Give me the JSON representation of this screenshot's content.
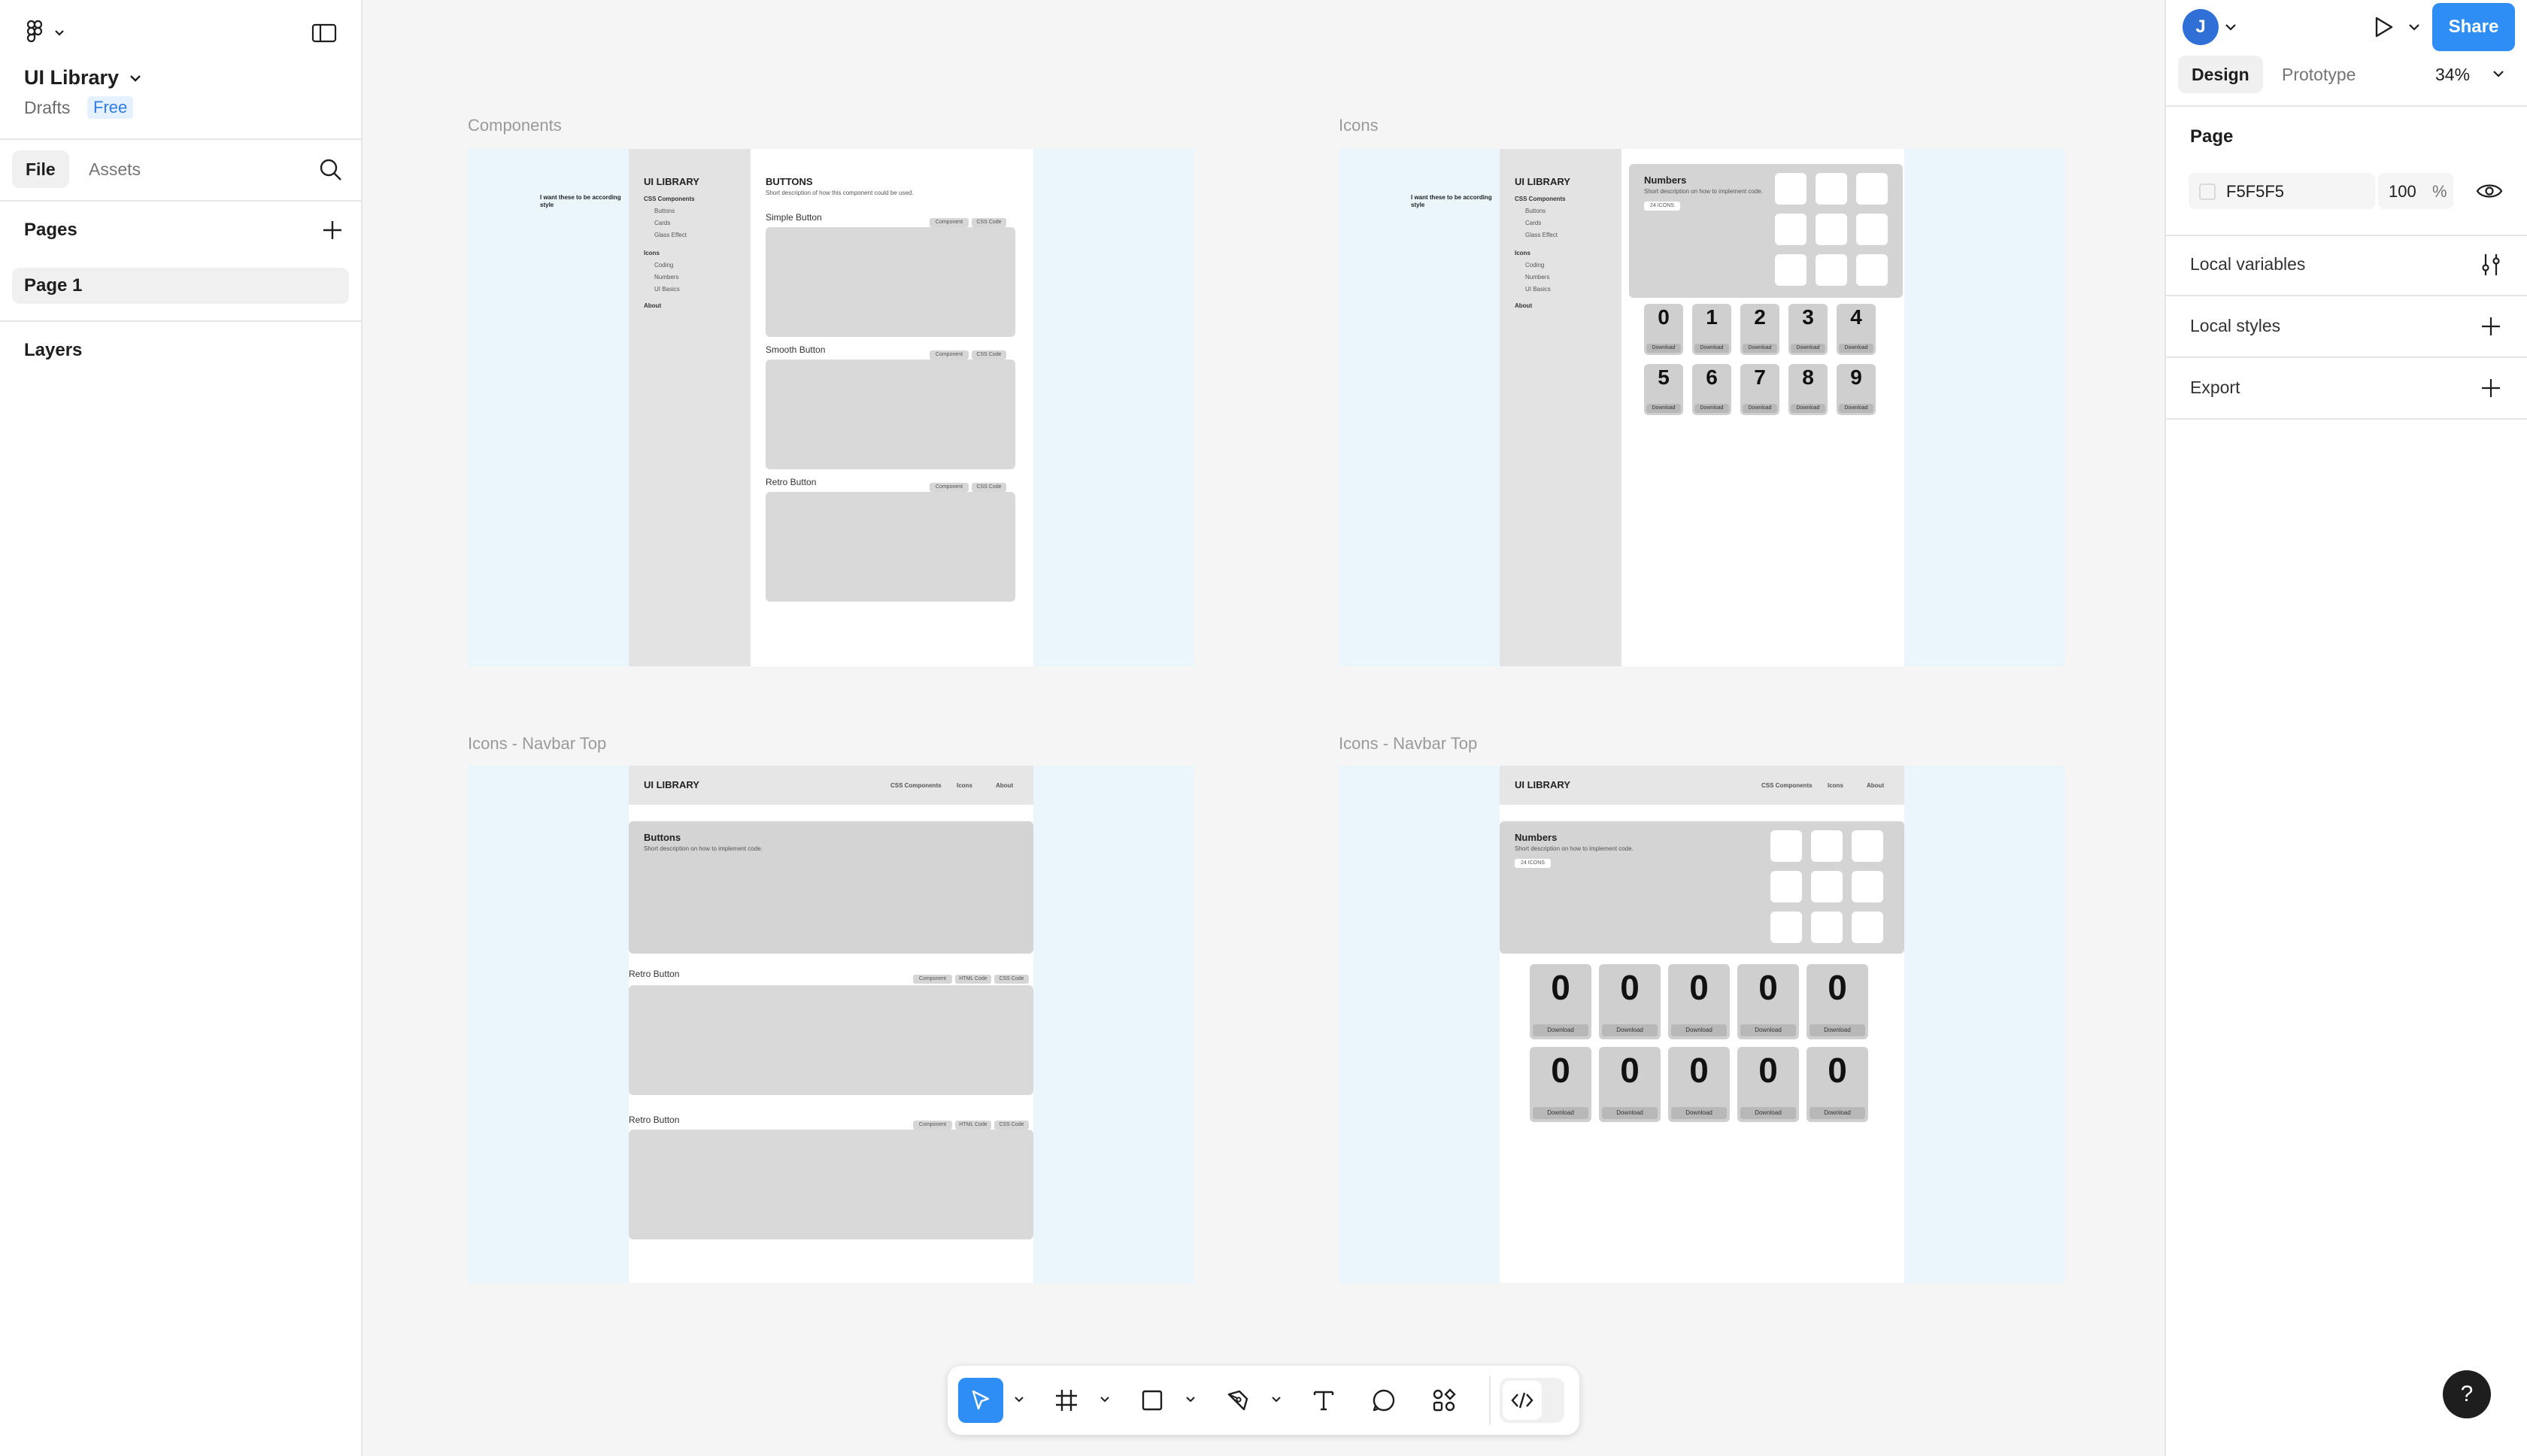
{
  "left_panel": {
    "file_name": "UI Library",
    "location": "Drafts",
    "plan": "Free",
    "tabs": [
      "File",
      "Assets"
    ],
    "pages_heading": "Pages",
    "pages": [
      "Page 1"
    ],
    "layers_heading": "Layers"
  },
  "right_panel": {
    "avatar_initial": "J",
    "share_label": "Share",
    "tabs": [
      "Design",
      "Prototype"
    ],
    "zoom": "34%",
    "page_heading": "Page",
    "page_color": "F5F5F5",
    "page_opacity": "100",
    "percent": "%",
    "local_variables": "Local variables",
    "local_styles": "Local styles",
    "export": "Export",
    "help": "?"
  },
  "frames": {
    "components": {
      "label": "Components",
      "note": "I want these to be according style",
      "brand": "UI LIBRARY",
      "nav": [
        "CSS Components",
        "Buttons",
        "Cards",
        "Glass Effect",
        "Icons",
        "Coding",
        "Numbers",
        "UI Basics",
        "About"
      ],
      "heading": "BUTTONS",
      "subheading": "Short description of how this component could be used.",
      "sections": [
        "Simple Button",
        "Smooth Button",
        "Retro Button"
      ],
      "pill_a": "Component",
      "pill_b": "CSS Code"
    },
    "icons": {
      "label": "Icons",
      "note": "I want these to be according style",
      "brand": "UI LIBRARY",
      "nav": [
        "CSS Components",
        "Buttons",
        "Cards",
        "Glass Effect",
        "Icons",
        "Coding",
        "Numbers",
        "UI Basics",
        "About"
      ],
      "heading": "Numbers",
      "subheading": "Short description on how to implement code.",
      "badge": "24 ICONS",
      "digits": [
        "0",
        "1",
        "2",
        "3",
        "4",
        "5",
        "6",
        "7",
        "8",
        "9"
      ],
      "download": "Download"
    },
    "navbar_a": {
      "label": "Icons - Navbar Top",
      "brand": "UI LIBRARY",
      "nav": [
        "CSS Components",
        "Icons",
        "About"
      ],
      "heading": "Buttons",
      "subheading": "Short description on how to implement code.",
      "sections": [
        "Retro Button",
        "Retro Button"
      ],
      "pills": [
        "Component",
        "HTML Code",
        "CSS Code"
      ]
    },
    "navbar_b": {
      "label": "Icons - Navbar Top",
      "brand": "UI LIBRARY",
      "nav": [
        "CSS Components",
        "Icons",
        "About"
      ],
      "heading": "Numbers",
      "subheading": "Short description on how to implement code.",
      "badge": "24 ICONS",
      "digit": "0",
      "download": "Download"
    }
  }
}
